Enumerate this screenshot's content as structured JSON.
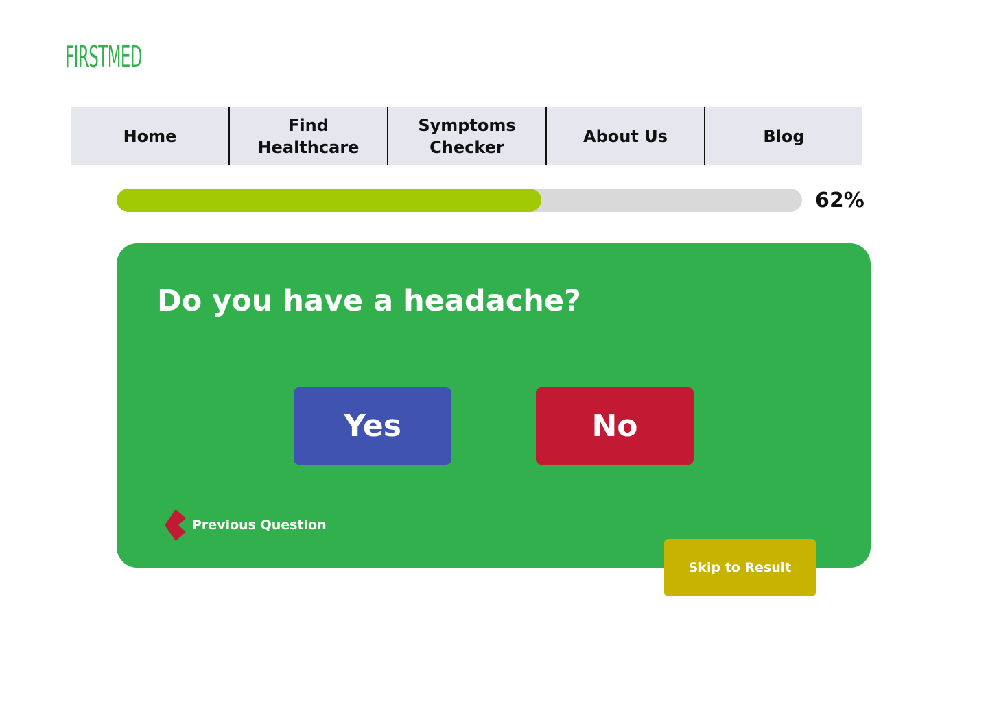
{
  "brand": {
    "logo_text": "FIRSTMED",
    "color": "#32b04d"
  },
  "nav": {
    "items": [
      {
        "label": "Home"
      },
      {
        "label": "Find Healthcare"
      },
      {
        "label": "Symptoms Checker"
      },
      {
        "label": "About Us"
      },
      {
        "label": "Blog"
      }
    ]
  },
  "progress": {
    "value": 0.62,
    "label": "62%",
    "fill_color": "#a1c904",
    "track_color": "#d9d9d9"
  },
  "question": {
    "text": "Do you have a headache?",
    "card_color": "#32b04d"
  },
  "answers": {
    "yes_label": "Yes",
    "yes_color": "#4153b1",
    "no_label": "No",
    "no_color": "#c11a32"
  },
  "previous": {
    "label": "Previous Question",
    "icon": "chevron-left-icon",
    "icon_color": "#c11a32"
  },
  "skip": {
    "label": "Skip to Result",
    "color": "#c8b400"
  }
}
